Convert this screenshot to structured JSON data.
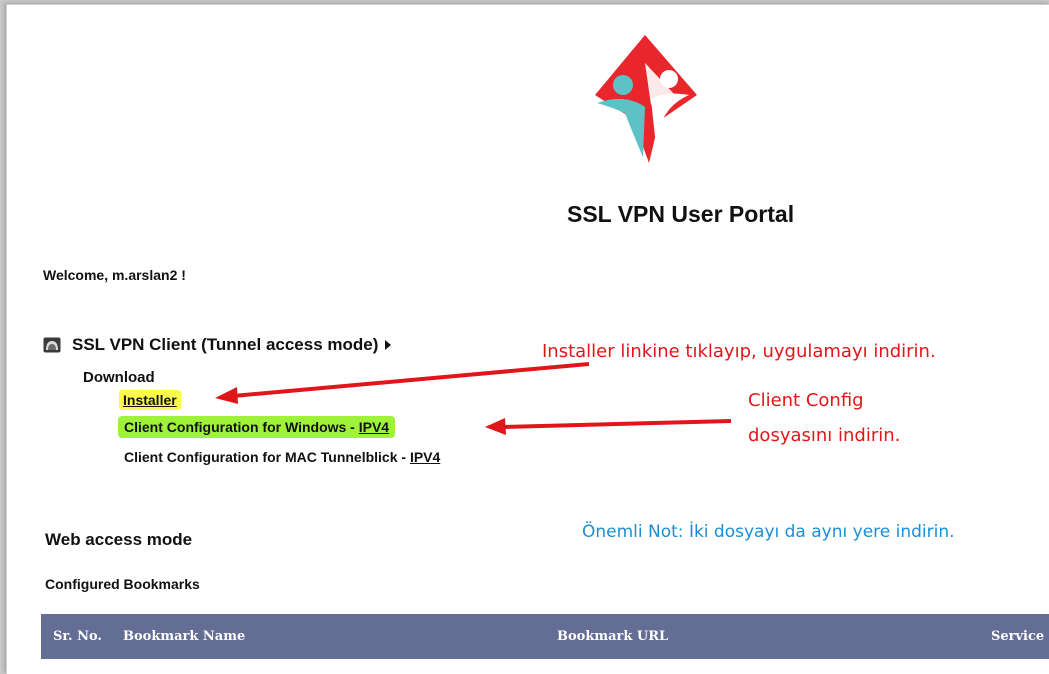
{
  "portal": {
    "title": "SSL VPN User Portal",
    "welcome": "Welcome, m.arslan2 !"
  },
  "tunnel": {
    "title": "SSL VPN Client (Tunnel access mode)",
    "download_label": "Download",
    "installer_label": "Installer",
    "windows_config_text": "Client Configuration for Windows - ",
    "windows_config_link": "IPV4",
    "mac_config_text": "Client Configuration for MAC Tunnelblick - ",
    "mac_config_link": "IPV4"
  },
  "annotations": {
    "installer_note": "Installer linkine tıklayıp, uygulamayı indirin.",
    "config_note_line1": "Client Config",
    "config_note_line2": "dosyasını indirin.",
    "important_note": "Önemli Not: İki dosyayı da aynı yere indirin."
  },
  "web_access": {
    "title": "Web access mode",
    "bookmarks_title": "Configured Bookmarks",
    "columns": [
      "Sr. No.",
      "Bookmark Name",
      "Bookmark URL",
      "Service"
    ]
  },
  "colors": {
    "table_header": "#646e95",
    "annotation_red": "#e0171a",
    "note_blue": "#1a8fd6",
    "highlight_yellow": "#fbfb4a",
    "highlight_green": "#9ef33a"
  }
}
